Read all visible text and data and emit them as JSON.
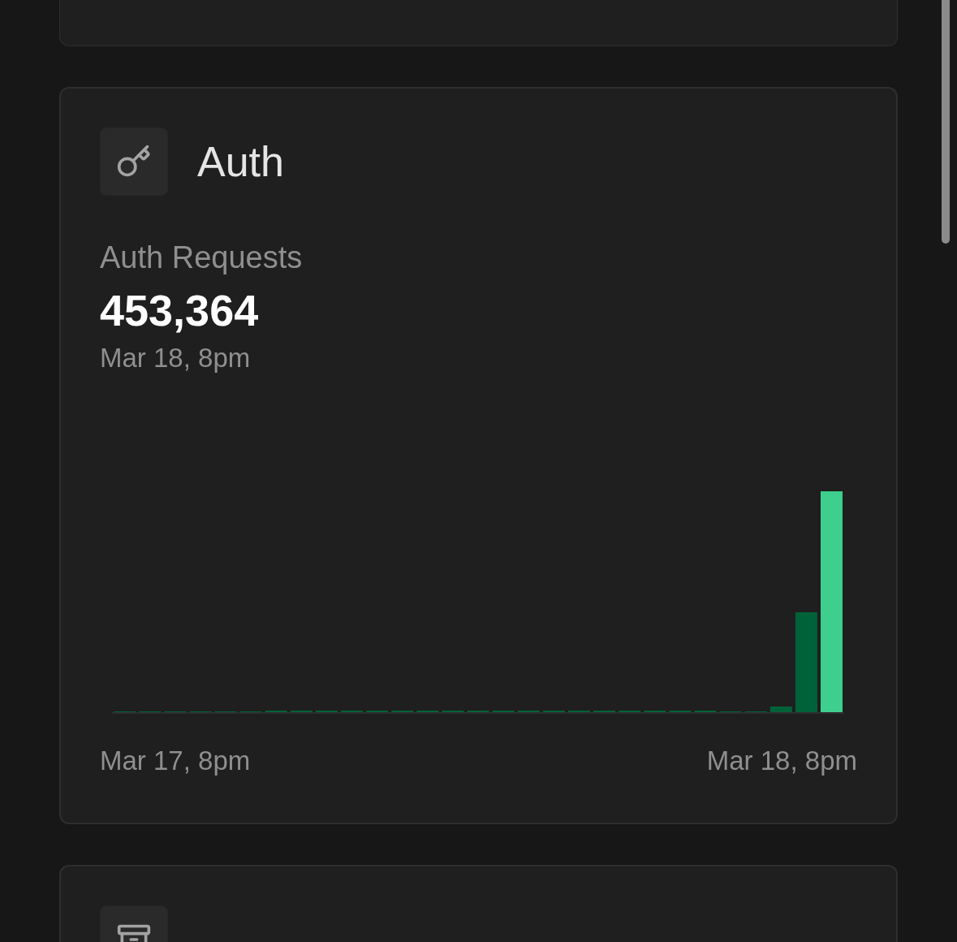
{
  "cards": [
    {
      "kind": "cut_top"
    },
    {
      "kind": "metric",
      "title": "Auth",
      "metric_label": "Auth Requests",
      "metric_value": "453,364",
      "metric_time": "Mar 18, 8pm",
      "chart_start": "Mar 17, 8pm",
      "chart_end": "Mar 18, 8pm"
    },
    {
      "kind": "cut_bottom"
    }
  ]
}
